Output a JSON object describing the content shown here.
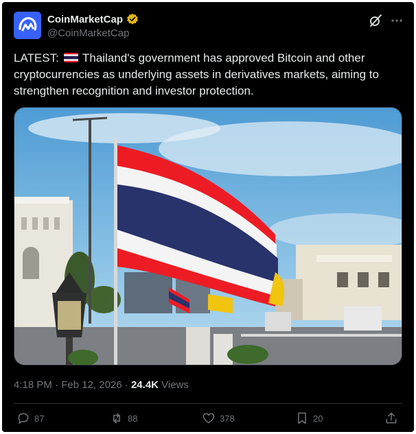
{
  "post": {
    "author_name": "CoinMarketCap",
    "author_handle": "@CoinMarketCap",
    "text_prefix": "LATEST:",
    "text_body": "Thailand's government has approved Bitcoin and other cryptocurrencies as underlying assets in derivatives markets, aiming to strengthen recognition and investor protection.",
    "time": "4:18 PM",
    "separator": " · ",
    "date": "Feb 12, 2026",
    "views_count": "24.4K",
    "views_label": " Views"
  },
  "actions": {
    "replies": "87",
    "reposts": "88",
    "likes": "378",
    "bookmarks": "20"
  },
  "icons": {
    "avatar": "coinmarketcap-logo",
    "verified": "gold-check-badge",
    "grok": "grok-icon",
    "more": "more-icon",
    "reply": "reply-icon",
    "repost": "repost-icon",
    "like": "heart-icon",
    "bookmark": "bookmark-icon",
    "share": "share-icon"
  },
  "colors": {
    "background": "#000000",
    "text": "#e7e9ea",
    "muted": "#71767b",
    "brand": "#3861fb",
    "verified_gold": "#e2b719"
  }
}
